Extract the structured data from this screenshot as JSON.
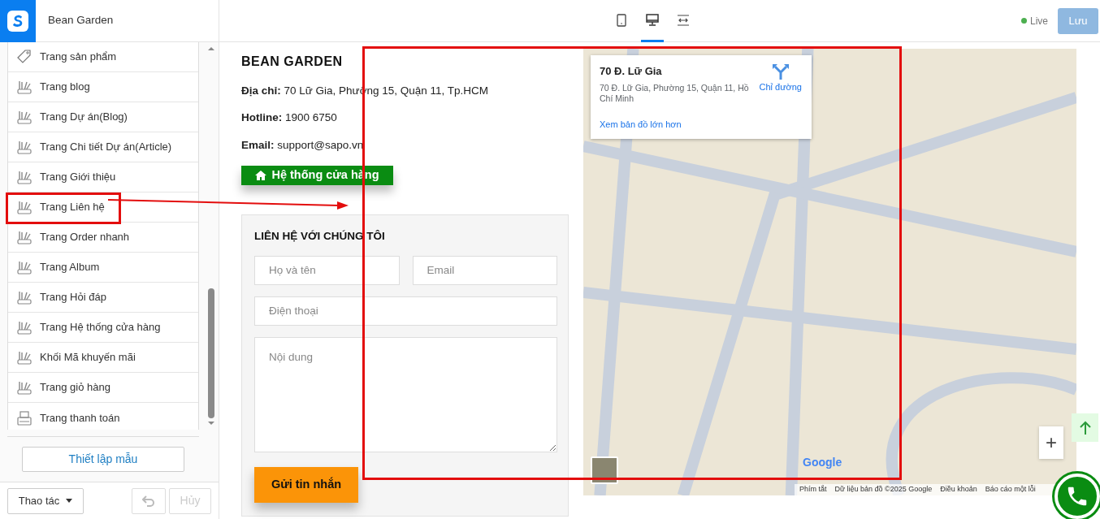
{
  "store_name": "Bean Garden",
  "device_tabs": [
    {
      "kind": "mobile",
      "selected": false
    },
    {
      "kind": "desktop",
      "selected": true
    },
    {
      "kind": "fullwidth",
      "selected": false
    }
  ],
  "status": {
    "label": "Live",
    "color": "#4caf50"
  },
  "save_button": {
    "label": "Lưu",
    "disabled": true
  },
  "sidebar": {
    "items": [
      {
        "label": "Trang sản phẩm",
        "kind": "tag",
        "highlighted": false
      },
      {
        "label": "Trang blog",
        "kind": "template",
        "highlighted": false
      },
      {
        "label": "Trang Dự án(Blog)",
        "kind": "template",
        "highlighted": false
      },
      {
        "label": "Trang Chi tiết Dự án(Article)",
        "kind": "template",
        "highlighted": false
      },
      {
        "label": "Trang Giới thiệu",
        "kind": "template",
        "highlighted": false
      },
      {
        "label": "Trang Liên hệ",
        "kind": "template",
        "highlighted": true
      },
      {
        "label": "Trang Order nhanh",
        "kind": "template",
        "highlighted": false
      },
      {
        "label": "Trang Album",
        "kind": "template",
        "highlighted": false
      },
      {
        "label": "Trang Hỏi đáp",
        "kind": "template",
        "highlighted": false
      },
      {
        "label": "Trang Hệ thống cửa hàng",
        "kind": "template",
        "highlighted": false
      },
      {
        "label": "Khối Mã khuyến mãi",
        "kind": "template",
        "highlighted": false
      },
      {
        "label": "Trang giỏ hàng",
        "kind": "template",
        "highlighted": false
      },
      {
        "label": "Trang thanh toán",
        "kind": "checkout",
        "highlighted": false
      }
    ],
    "setup_button": "Thiết lập mẫu",
    "actions_button": "Thao tác",
    "undo_disabled": true,
    "cancel_button": {
      "label": "Hủy",
      "disabled": true
    }
  },
  "preview": {
    "heading": "BEAN GARDEN",
    "info": [
      "**Địa chỉ:** 70 Lữ Gia, Phường 15, Quận 11, Tp.HCM",
      "**Hotline:** 1900 6750",
      "**Email:** support@sapo.vn"
    ],
    "store_button": "Hệ thống cửa hàng",
    "form": {
      "title": "LIÊN HỆ VỚI CHÚNG TÔI",
      "name_placeholder": "Họ và tên",
      "email_placeholder": "Email",
      "phone_placeholder": "Điện thoại",
      "message_placeholder": "Nội dung",
      "submit": "Gửi tin nhắn"
    },
    "map": {
      "place_title": "70 Đ. Lữ Gia",
      "place_address": "70 Đ. Lữ Gia, Phường 15, Quận 11, Hồ Chí Minh",
      "directions": "Chỉ đường",
      "larger_map": "Xem bản đồ lớn hơn",
      "zoom_in": "+",
      "logo": "Google",
      "footer": [
        "Phím tắt",
        "Dữ liệu bản đồ ©2025 Google",
        "Điều khoản",
        "Báo cáo một lỗi"
      ]
    }
  },
  "annotations": {
    "arrow": true,
    "frame": true
  }
}
